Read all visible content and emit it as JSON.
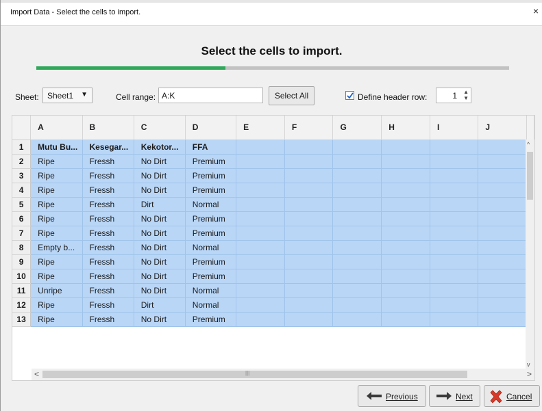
{
  "window": {
    "title": "Import Data - Select the cells to import.",
    "close_glyph": "×"
  },
  "heading": "Select the cells to import.",
  "progress": {
    "fraction": 0.4,
    "color": "#2fa85a"
  },
  "controls": {
    "sheet_label": "Sheet:",
    "sheet_value": "Sheet1",
    "cell_range_label": "Cell range:",
    "cell_range_value": "A:K",
    "select_all_label": "Select All",
    "define_header_label": "Define header row:",
    "define_header_checked": true,
    "header_row_value": "1"
  },
  "grid": {
    "columns": [
      "A",
      "B",
      "C",
      "D",
      "E",
      "F",
      "G",
      "H",
      "I",
      "J"
    ],
    "rows": [
      {
        "num": "1",
        "cells": [
          "Mutu Bu...",
          "Kesegar...",
          "Kekotor...",
          "FFA",
          "",
          "",
          "",
          "",
          "",
          ""
        ]
      },
      {
        "num": "2",
        "cells": [
          "Ripe",
          "Fressh",
          "No Dirt",
          "Premium",
          "",
          "",
          "",
          "",
          "",
          ""
        ]
      },
      {
        "num": "3",
        "cells": [
          "Ripe",
          "Fressh",
          "No Dirt",
          "Premium",
          "",
          "",
          "",
          "",
          "",
          ""
        ]
      },
      {
        "num": "4",
        "cells": [
          "Ripe",
          "Fressh",
          "No Dirt",
          "Premium",
          "",
          "",
          "",
          "",
          "",
          ""
        ]
      },
      {
        "num": "5",
        "cells": [
          "Ripe",
          "Fressh",
          "Dirt",
          "Normal",
          "",
          "",
          "",
          "",
          "",
          ""
        ]
      },
      {
        "num": "6",
        "cells": [
          "Ripe",
          "Fressh",
          "No Dirt",
          "Premium",
          "",
          "",
          "",
          "",
          "",
          ""
        ]
      },
      {
        "num": "7",
        "cells": [
          "Ripe",
          "Fressh",
          "No Dirt",
          "Premium",
          "",
          "",
          "",
          "",
          "",
          ""
        ]
      },
      {
        "num": "8",
        "cells": [
          "Empty b...",
          "Fressh",
          "No Dirt",
          "Normal",
          "",
          "",
          "",
          "",
          "",
          ""
        ]
      },
      {
        "num": "9",
        "cells": [
          "Ripe",
          "Fressh",
          "No Dirt",
          "Premium",
          "",
          "",
          "",
          "",
          "",
          ""
        ]
      },
      {
        "num": "10",
        "cells": [
          "Ripe",
          "Fressh",
          "No Dirt",
          "Premium",
          "",
          "",
          "",
          "",
          "",
          ""
        ]
      },
      {
        "num": "11",
        "cells": [
          "Unripe",
          "Fressh",
          "No Dirt",
          "Normal",
          "",
          "",
          "",
          "",
          "",
          ""
        ]
      },
      {
        "num": "12",
        "cells": [
          "Ripe",
          "Fressh",
          "Dirt",
          "Normal",
          "",
          "",
          "",
          "",
          "",
          ""
        ]
      },
      {
        "num": "13",
        "cells": [
          "Ripe",
          "Fressh",
          "No Dirt",
          "Premium",
          "",
          "",
          "",
          "",
          "",
          ""
        ]
      }
    ]
  },
  "buttons": {
    "previous_label": "Previous",
    "next_label": "Next",
    "cancel_label": "Cancel"
  },
  "icons": {
    "previous": "arrow-left-icon",
    "next": "arrow-right-icon",
    "cancel": "red-x-icon"
  }
}
